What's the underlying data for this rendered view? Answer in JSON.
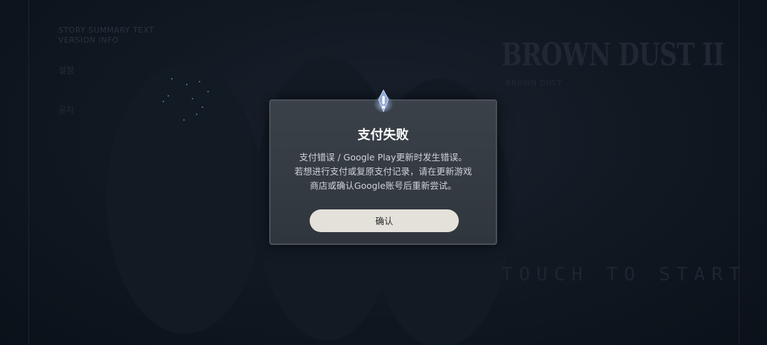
{
  "background": {
    "top_left_line_1": "STORY SUMMARY TEXT",
    "top_left_line_2": "VERSION INFO",
    "left_label_1": "설정",
    "left_label_2": "공지",
    "logo_text": "BROWN DUST II",
    "logo_subtitle": "BROWN DUST",
    "touch_to_start": "TOUCH TO START"
  },
  "dialog": {
    "icon": "alert-exclamation-icon",
    "title": "支付失败",
    "message_lines": [
      "支付错误 / Google Play更新时发生错误。",
      "若想进行支付或复原支付记录，请在更新游戏",
      "商店或确认Google账号后重新尝试。"
    ],
    "confirm_label": "确认"
  },
  "colors": {
    "overlay": "#0c121b",
    "dialog_bg": "#353b42",
    "dialog_border": "#4a5159",
    "button_bg": "#e4e1da",
    "icon_accent": "#8fa8d8"
  }
}
